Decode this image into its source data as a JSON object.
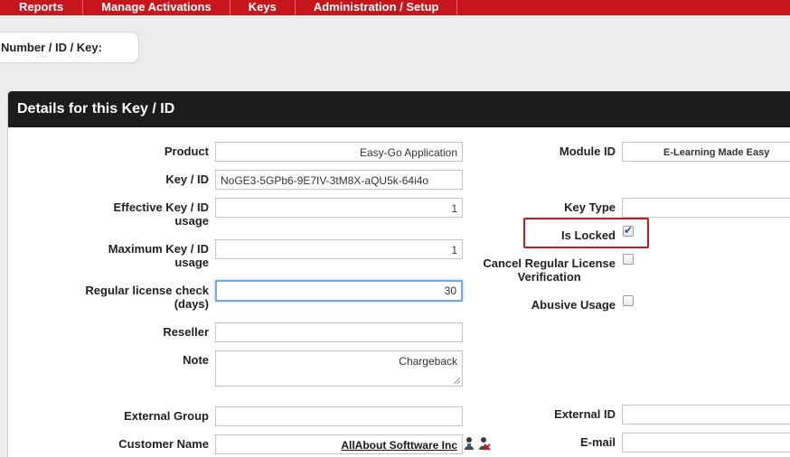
{
  "nav": {
    "items": [
      "Reports",
      "Manage Activations",
      "Keys",
      "Administration / Setup"
    ]
  },
  "search": {
    "label": "Number / ID / Key:"
  },
  "panel": {
    "title": "Details for this Key / ID"
  },
  "form": {
    "product": {
      "label": "Product",
      "value": "Easy-Go Application"
    },
    "key_id": {
      "label": "Key / ID",
      "value": "NoGE3-5GPb6-9E7IV-3tM8X-aQU5k-64i4o"
    },
    "effective_usage": {
      "label_line1": "Effective Key / ID",
      "label_line2": "usage",
      "value": "1"
    },
    "maximum_usage": {
      "label_line1": "Maximum Key / ID",
      "label_line2": "usage",
      "value": "1"
    },
    "license_check": {
      "label_line1": "Regular license check",
      "label_line2": "(days)",
      "value": "30"
    },
    "reseller": {
      "label": "Reseller",
      "value": ""
    },
    "note": {
      "label": "Note",
      "value": "Chargeback"
    },
    "external_group": {
      "label": "External Group",
      "value": ""
    },
    "customer_name": {
      "label": "Customer Name",
      "value": "AllAbout Softtware Inc"
    },
    "module_id": {
      "label": "Module ID",
      "value": "E-Learning Made Easy"
    },
    "key_type": {
      "label": "Key Type",
      "value": ""
    },
    "is_locked": {
      "label": "Is Locked",
      "checked": true
    },
    "cancel_verification": {
      "label_line1": "Cancel Regular License",
      "label_line2": "Verification",
      "checked": false
    },
    "abusive_usage": {
      "label": "Abusive Usage",
      "checked": false
    },
    "external_id": {
      "label": "External ID",
      "value": ""
    },
    "email": {
      "label": "E-mail",
      "value": ""
    }
  },
  "colors": {
    "nav_bg": "#c8161d",
    "header_bg": "#1c1c1c",
    "highlight": "#d4151b"
  }
}
